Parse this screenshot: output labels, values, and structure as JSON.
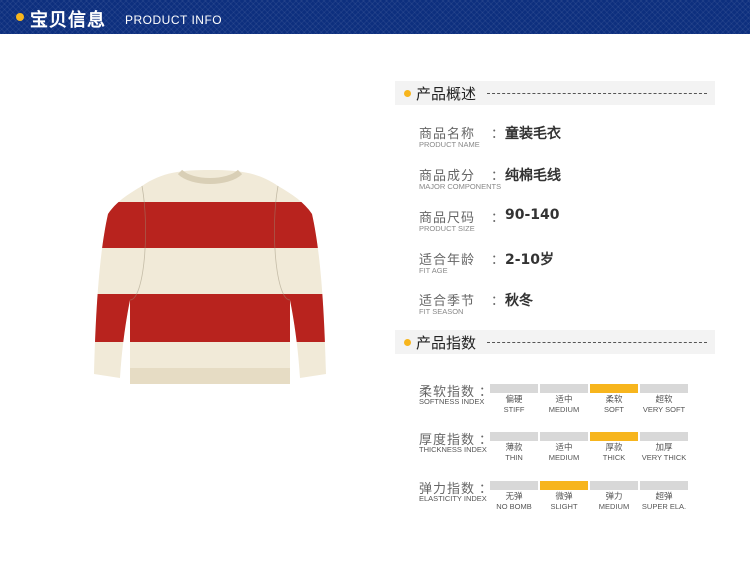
{
  "banner": {
    "title": "宝贝信息",
    "subtitle": "PRODUCT INFO"
  },
  "colors": {
    "banner": "#0d2f7e",
    "accent": "#f7b51d",
    "sweater_red": "#b8231e",
    "sweater_cream": "#f1ead8"
  },
  "overview": {
    "title": "产品概述",
    "rows": [
      {
        "label": "商品名称",
        "sub": "PRODUCT NAME",
        "value": "童装毛衣"
      },
      {
        "label": "商品成分",
        "sub": "MAJOR COMPONENTS",
        "value": "纯棉毛线"
      },
      {
        "label": "商品尺码",
        "sub": "PRODUCT SIZE",
        "value": "90-140"
      },
      {
        "label": "适合年龄",
        "sub": "FIT AGE",
        "value": "2-10岁"
      },
      {
        "label": "适合季节",
        "sub": "FIT SEASON",
        "value": "秋冬"
      }
    ]
  },
  "indices": {
    "title": "产品指数",
    "rows": [
      {
        "label": "柔软指数",
        "sub": "SOFTNESS INDEX",
        "selected": 2,
        "options": [
          {
            "cn": "偏硬",
            "en": "STIFF"
          },
          {
            "cn": "适中",
            "en": "MEDIUM"
          },
          {
            "cn": "柔软",
            "en": "SOFT"
          },
          {
            "cn": "超软",
            "en": "VERY SOFT"
          }
        ]
      },
      {
        "label": "厚度指数",
        "sub": "THICKNESS INDEX",
        "selected": 2,
        "options": [
          {
            "cn": "薄款",
            "en": "THIN"
          },
          {
            "cn": "适中",
            "en": "MEDIUM"
          },
          {
            "cn": "厚款",
            "en": "THICK"
          },
          {
            "cn": "加厚",
            "en": "VERY THICK"
          }
        ]
      },
      {
        "label": "弹力指数",
        "sub": "ELASTICITY INDEX",
        "selected": 1,
        "options": [
          {
            "cn": "无弹",
            "en": "NO BOMB"
          },
          {
            "cn": "微弹",
            "en": "SLIGHT"
          },
          {
            "cn": "弹力",
            "en": "MEDIUM"
          },
          {
            "cn": "超弹",
            "en": "SUPER ELA."
          }
        ]
      }
    ]
  }
}
